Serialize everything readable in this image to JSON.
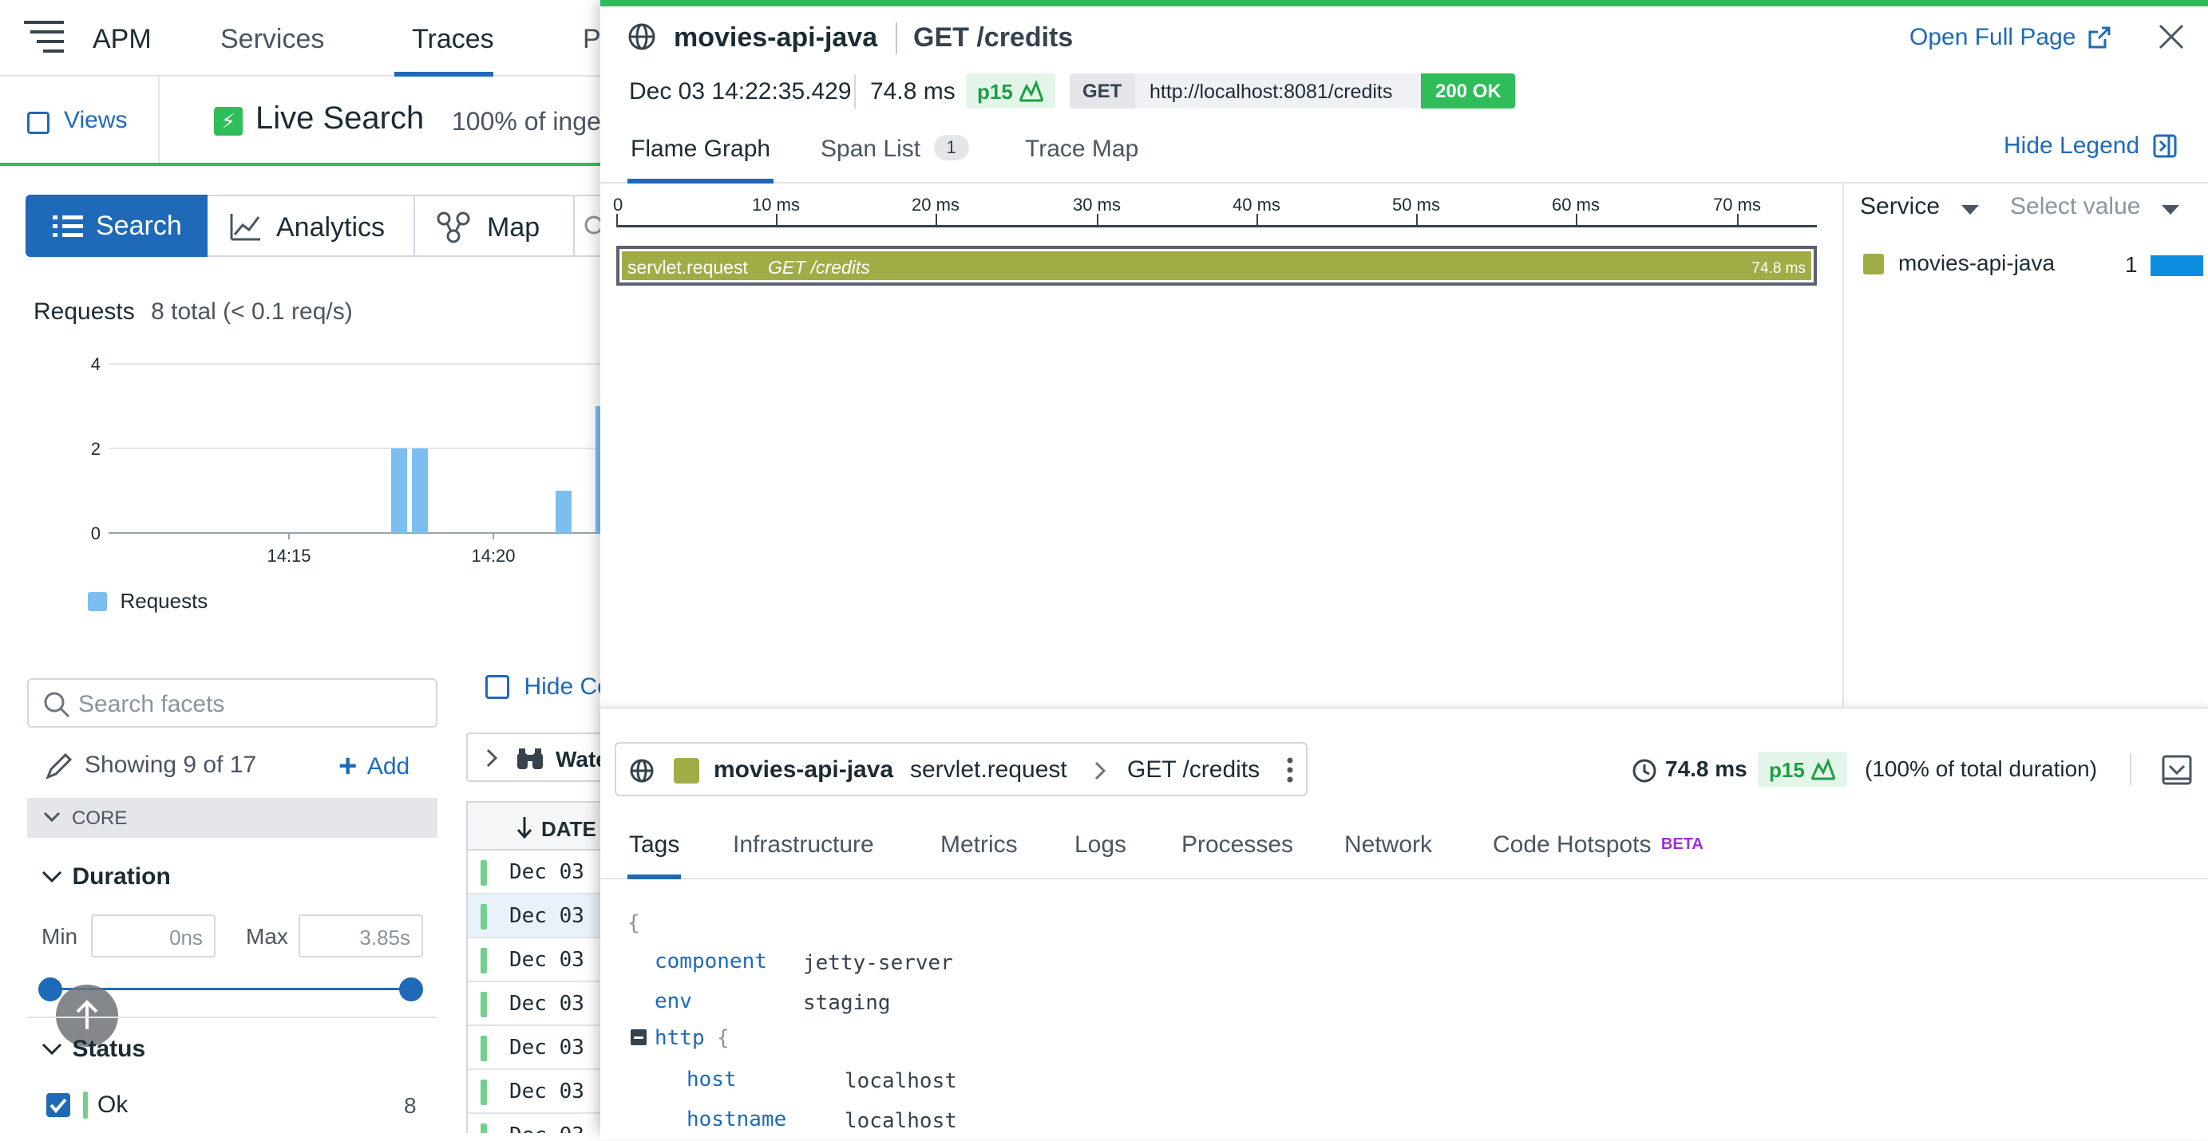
{
  "topnav": {
    "logo": "APM",
    "items": [
      "Services",
      "Traces",
      "P"
    ]
  },
  "subheader": {
    "views": "Views",
    "live_search": "Live Search",
    "ingest_note": "100% of inge"
  },
  "modes": {
    "search": "Search",
    "analytics": "Analytics",
    "map": "Map"
  },
  "requests_chart": {
    "title": "Requests",
    "total": "8 total (< 0.1 req/s)",
    "legend": "Requests"
  },
  "chart_data": {
    "type": "bar",
    "ylim": [
      0,
      4
    ],
    "yticks": [
      "4",
      "2",
      "0"
    ],
    "xticks": [
      "14:15",
      "14:20"
    ],
    "series": [
      {
        "name": "Requests",
        "values": [
          2,
          2,
          1,
          3
        ]
      }
    ]
  },
  "facets": {
    "search_placeholder": "Search facets",
    "showing": "Showing 9 of 17",
    "add": "Add",
    "core": "CORE",
    "duration": "Duration",
    "min_label": "Min",
    "min_value": "0ns",
    "max_label": "Max",
    "max_value": "3.85s",
    "status": "Status",
    "status_ok": "Ok",
    "status_ok_count": "8"
  },
  "list": {
    "hide_controls": "Hide Co",
    "watchdog": "Wate",
    "date_header": "DATE",
    "rows": [
      "Dec 03",
      "Dec 03",
      "Dec 03",
      "Dec 03",
      "Dec 03",
      "Dec 03",
      "Dec 03"
    ]
  },
  "panel": {
    "service": "movies-api-java",
    "resource": "GET /credits",
    "open_full_page": "Open Full Page",
    "timestamp": "Dec 03 14:22:35.429",
    "duration": "74.8 ms",
    "percentile": "p15",
    "method": "GET",
    "url": "http://localhost:8081/credits",
    "status": "200 OK",
    "tabs": {
      "flame": "Flame Graph",
      "spans": "Span List",
      "spans_count": "1",
      "map": "Trace Map"
    },
    "hide_legend": "Hide Legend",
    "timeline_ticks": [
      "0",
      "10 ms",
      "20 ms",
      "30 ms",
      "40 ms",
      "50 ms",
      "60 ms",
      "70 ms"
    ],
    "span": {
      "name": "servlet.request",
      "resource": "GET /credits",
      "duration": "74.8 ms"
    },
    "legend": {
      "service_label": "Service",
      "select_placeholder": "Select value",
      "items": [
        {
          "name": "movies-api-java",
          "count": "1"
        }
      ]
    },
    "colors": {
      "service": "#a0ad47",
      "accent": "#1e6ab8",
      "ok": "#2ebd59"
    }
  },
  "span_detail": {
    "service": "movies-api-java",
    "operation": "servlet.request",
    "resource": "GET /credits",
    "duration": "74.8 ms",
    "percentile": "p15",
    "pct_note": "(100% of total duration)",
    "tabs": [
      "Tags",
      "Infrastructure",
      "Metrics",
      "Logs",
      "Processes",
      "Network",
      "Code Hotspots"
    ],
    "beta": "BETA",
    "tags": {
      "open_brace": "{",
      "component_key": "component",
      "component_val": "jetty-server",
      "env_key": "env",
      "env_val": "staging",
      "http_key": "http",
      "http_brace": "{",
      "host_key": "host",
      "host_val": "localhost",
      "hostname_key": "hostname",
      "hostname_val": "localhost"
    }
  }
}
